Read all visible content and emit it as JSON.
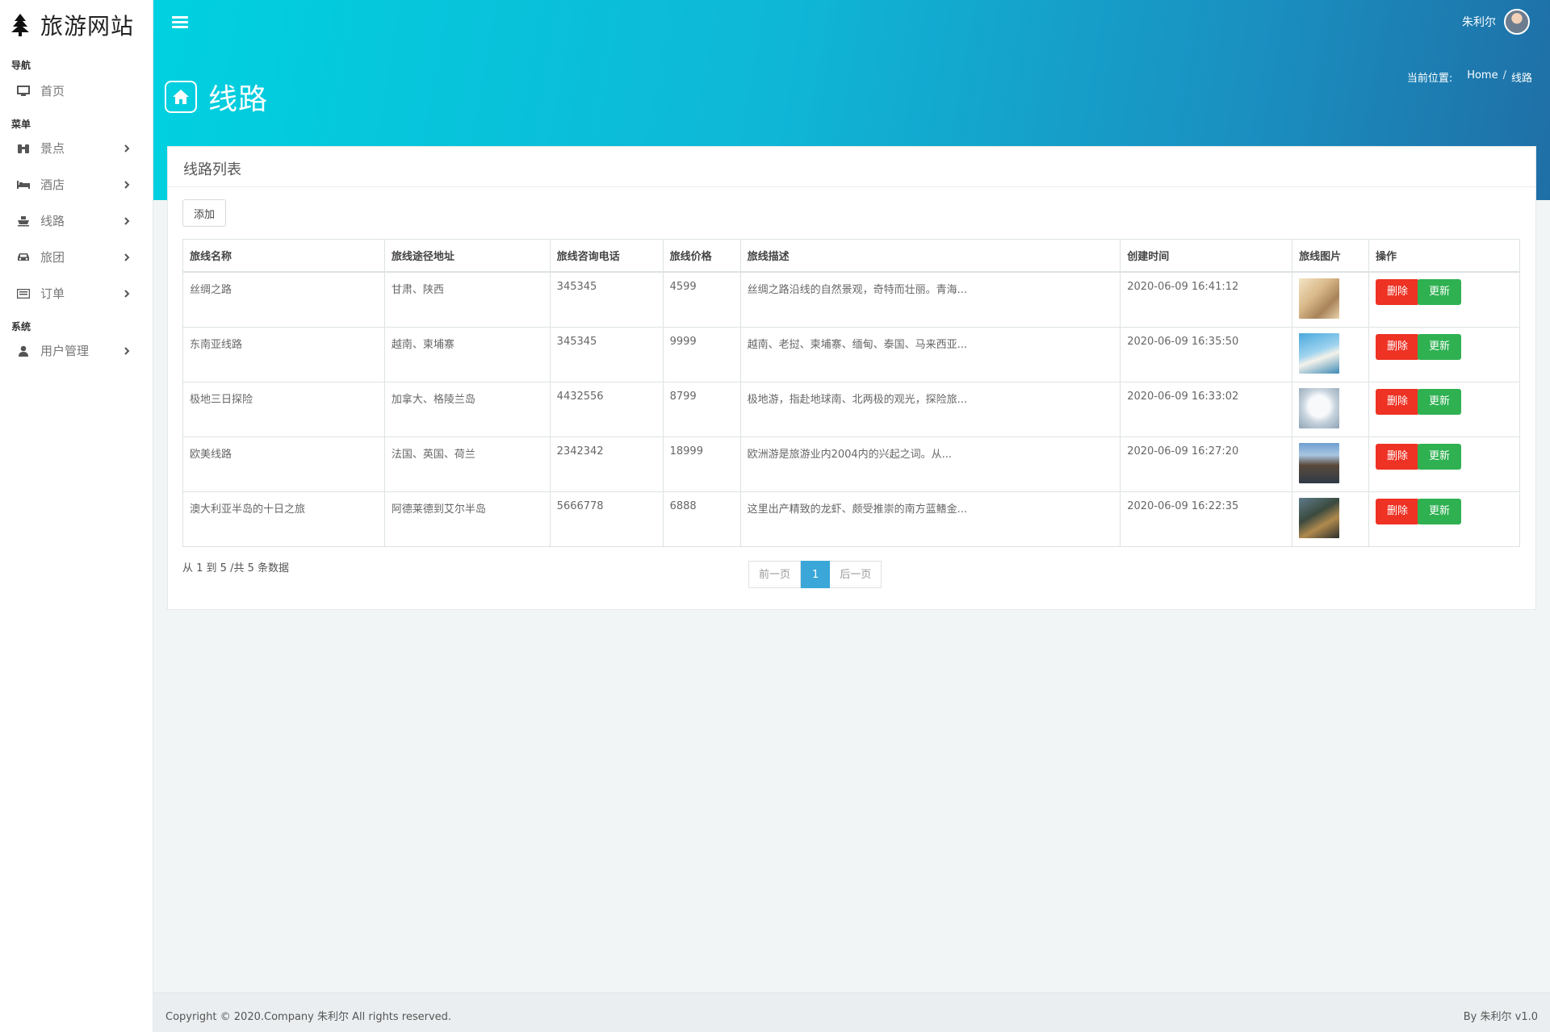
{
  "sidebar": {
    "brand": "旅游网站",
    "sections": {
      "nav": "导航",
      "menu": "菜单",
      "system": "系统"
    },
    "items": [
      {
        "label": "首页",
        "icon": "desktop-icon"
      },
      {
        "label": "景点",
        "icon": "binoculars-icon"
      },
      {
        "label": "酒店",
        "icon": "bed-icon"
      },
      {
        "label": "线路",
        "icon": "ship-icon"
      },
      {
        "label": "旅团",
        "icon": "car-icon"
      },
      {
        "label": "订单",
        "icon": "list-icon"
      },
      {
        "label": "用户管理",
        "icon": "user-icon"
      }
    ]
  },
  "header": {
    "user_name": "朱利尔",
    "page_title": "线路",
    "breadcrumb": {
      "label": "当前位置:",
      "home": "Home",
      "sep": "/",
      "current": "线路"
    }
  },
  "card": {
    "title": "线路列表",
    "add_label": "添加",
    "columns": [
      "旅线名称",
      "旅线途径地址",
      "旅线咨询电话",
      "旅线价格",
      "旅线描述",
      "创建时间",
      "旅线图片",
      "操作"
    ],
    "rows": [
      {
        "name": "丝绸之路",
        "address": "甘肃、陕西",
        "phone": "345345",
        "price": "4599",
        "desc": "丝绸之路沿线的自然景观，奇特而壮丽。青海...",
        "created": "2020-06-09 16:41:12"
      },
      {
        "name": "东南亚线路",
        "address": "越南、柬埔寨",
        "phone": "345345",
        "price": "9999",
        "desc": "越南、老挝、柬埔寨、缅甸、泰国、马来西亚...",
        "created": "2020-06-09 16:35:50"
      },
      {
        "name": "极地三日探险",
        "address": "加拿大、格陵兰岛",
        "phone": "4432556",
        "price": "8799",
        "desc": "极地游，指赴地球南、北两极的观光，探险旅...",
        "created": "2020-06-09 16:33:02"
      },
      {
        "name": "欧美线路",
        "address": "法国、英国、荷兰",
        "phone": "2342342",
        "price": "18999",
        "desc": "欧洲游是旅游业内2004内的兴起之词。从...",
        "created": "2020-06-09 16:27:20"
      },
      {
        "name": "澳大利亚半岛的十日之旅",
        "address": "阿德莱德到艾尔半岛",
        "phone": "5666778",
        "price": "6888",
        "desc": "这里出产精致的龙虾、颇受推崇的南方蓝鳍金...",
        "created": "2020-06-09 16:22:35"
      }
    ],
    "delete_label": "删除",
    "update_label": "更新",
    "summary": "从 1 到 5 /共 5 条数据",
    "pager": {
      "prev": "前一页",
      "current": "1",
      "next": "后一页"
    }
  },
  "footer": {
    "copyright": "Copyright © 2020.Company 朱利尔 All rights reserved.",
    "version": "By 朱利尔 v1.0"
  },
  "colors": {
    "header_start": "#00d1e0",
    "header_end": "#1f6fa6",
    "delete": "#ee3224",
    "update": "#2fb152",
    "pager_active": "#3aa7d8"
  }
}
